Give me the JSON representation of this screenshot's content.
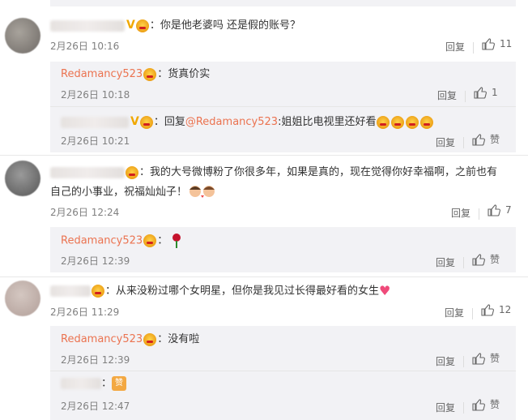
{
  "comments": [
    {
      "text": "：你是他老婆吗 还是假的账号？",
      "time": "2月26日 10:16",
      "reply_label": "回复",
      "like_count": "11",
      "replies": [
        {
          "author": "Redamancy523",
          "text": "：货真价实",
          "time": "2月26日 10:18",
          "reply_label": "回复",
          "like_count": "1"
        },
        {
          "prefix": "：回复",
          "mention": "@Redamancy523",
          "text": ":姐姐比电视里还好看",
          "time": "2月26日 10:21",
          "reply_label": "回复",
          "like_label": "赞"
        }
      ]
    },
    {
      "text_line1": "：我的大号微博粉了你很多年，如果是真的，现在觉得你好幸福啊，之前也有",
      "text_line2": "自己的小事业，祝福灿灿子！",
      "time": "2月26日 12:24",
      "reply_label": "回复",
      "like_count": "7",
      "replies": [
        {
          "author": "Redamancy523",
          "text": "：",
          "time": "2月26日 12:39",
          "reply_label": "回复",
          "like_label": "赞"
        }
      ]
    },
    {
      "text": "：从来没粉过哪个女明星，但你是我见过长得最好看的女生",
      "time": "2月26日 11:29",
      "reply_label": "回复",
      "like_count": "12",
      "replies": [
        {
          "author": "Redamancy523",
          "text": "：没有啦",
          "time": "2月26日 12:39",
          "reply_label": "回复",
          "like_label": "赞"
        },
        {
          "text": "：",
          "sticker_text": "赞",
          "time": "2月26日 12:47",
          "reply_label": "回复",
          "like_label": "赞"
        }
      ]
    }
  ],
  "colors": {
    "accent": "#eb7350",
    "reply_bg": "#f2f2f5",
    "meta": "#808080"
  },
  "icons": {
    "like": "thumbs-up-icon",
    "verified": "v-badge-icon",
    "member": "vip-crown-icon"
  }
}
